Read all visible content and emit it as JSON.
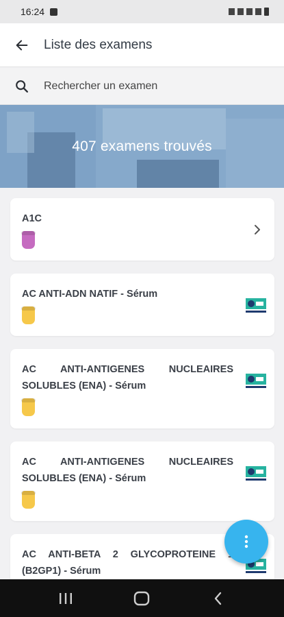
{
  "status_bar": {
    "time": "16:24"
  },
  "header": {
    "title": "Liste des examens"
  },
  "search": {
    "placeholder": "Rechercher un examen"
  },
  "banner": {
    "text": "407 examens trouvés"
  },
  "exams": [
    {
      "name": "A1C",
      "tube_color": "#c56bc0",
      "trailing": "chevron-right-icon"
    },
    {
      "name": "AC ANTI-ADN NATIF - Sérum",
      "tube_color": "#f6c84a",
      "trailing": "info-card-icon"
    },
    {
      "name": "AC ANTI-ANTIGENES NUCLEAIRES SOLUBLES (ENA) - Sérum",
      "tube_color": "#f6c84a",
      "trailing": "info-card-icon"
    },
    {
      "name": "AC ANTI-ANTIGENES NUCLEAIRES SOLUBLES (ENA) - Sérum",
      "tube_color": "#f6c84a",
      "trailing": "info-card-icon"
    },
    {
      "name": "AC ANTI-BETA 2 GLYCOPROTEINE 1 (B2GP1) - Sérum",
      "tube_color": "#f6c84a",
      "trailing": "info-card-icon"
    }
  ],
  "fab": {
    "icon": "more-vert-icon",
    "color": "#37b4ee"
  },
  "icons": {
    "back": "arrow-left-icon",
    "search": "search-icon",
    "nav": [
      "recent-apps-icon",
      "home-icon",
      "back-nav-icon"
    ]
  },
  "colors": {
    "banner": "#7ea3c6",
    "info_icon_teal": "#27b3a0",
    "info_icon_navy": "#1e3a6e"
  }
}
